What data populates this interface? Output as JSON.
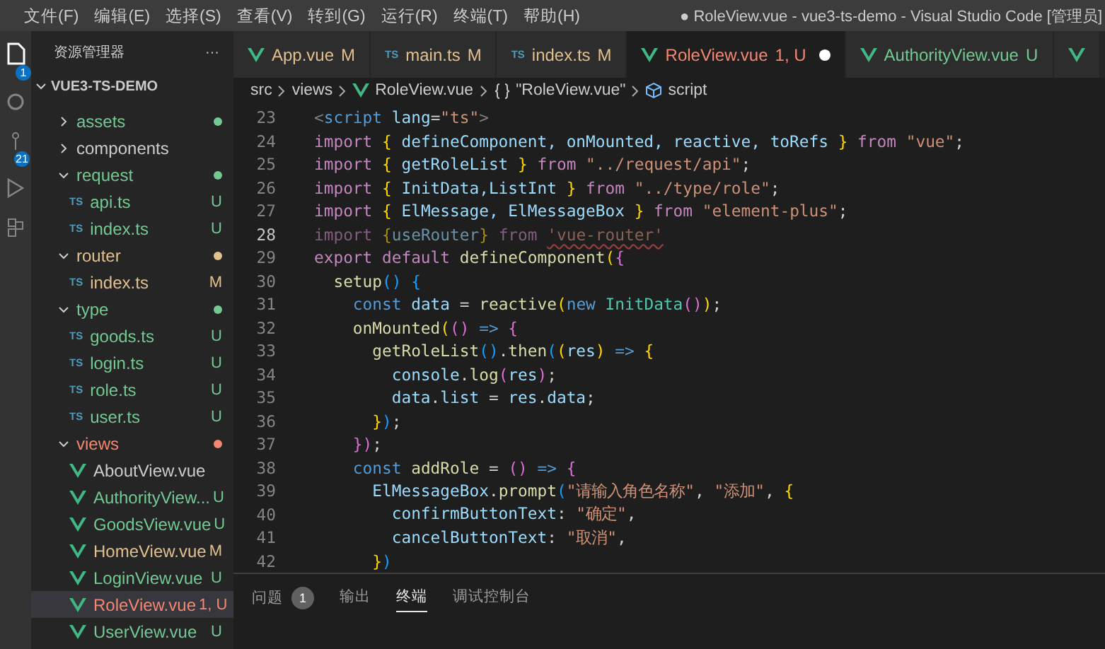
{
  "menu": [
    "文件(F)",
    "编辑(E)",
    "选择(S)",
    "查看(V)",
    "转到(G)",
    "运行(R)",
    "终端(T)",
    "帮助(H)"
  ],
  "window": {
    "title": "● RoleView.vue - vue3-ts-demo - Visual Studio Code [管理员]"
  },
  "activity_bar": {
    "explorer_badge": "1",
    "source_control_badge": "21"
  },
  "sidebar": {
    "title": "资源管理器",
    "more": "···",
    "section": "VUE3-TS-DEMO",
    "items": [
      {
        "label": "assets",
        "kind": "folder",
        "expanded": false,
        "color": "#73c991"
      },
      {
        "label": "components",
        "kind": "folder",
        "expanded": false,
        "color": "#cccccc"
      },
      {
        "label": "request",
        "kind": "folder",
        "expanded": true,
        "color": "#73c991",
        "children": [
          {
            "label": "api.ts",
            "kind": "ts",
            "icon_label": "TS",
            "badge": "U",
            "color": "#73c991",
            "selected": false
          },
          {
            "label": "index.ts",
            "kind": "ts",
            "icon_label": "TS",
            "badge": "U",
            "color": "#73c991",
            "selected": false
          }
        ]
      },
      {
        "label": "router",
        "kind": "folder",
        "expanded": true,
        "color": "#e2c08d",
        "children": [
          {
            "label": "index.ts",
            "kind": "ts",
            "icon_label": "TS",
            "badge": "M",
            "color": "#e2c08d",
            "selected": false
          }
        ]
      },
      {
        "label": "type",
        "kind": "folder",
        "expanded": true,
        "color": "#73c991",
        "children": [
          {
            "label": "goods.ts",
            "kind": "ts",
            "icon_label": "TS",
            "badge": "U",
            "color": "#73c991",
            "selected": false
          },
          {
            "label": "login.ts",
            "kind": "ts",
            "icon_label": "TS",
            "badge": "U",
            "color": "#73c991",
            "selected": false
          },
          {
            "label": "role.ts",
            "kind": "ts",
            "icon_label": "TS",
            "badge": "U",
            "color": "#73c991",
            "selected": false
          },
          {
            "label": "user.ts",
            "kind": "ts",
            "icon_label": "TS",
            "badge": "U",
            "color": "#73c991",
            "selected": false
          }
        ]
      },
      {
        "label": "views",
        "kind": "folder",
        "expanded": true,
        "color": "#f48771",
        "children": [
          {
            "label": "AboutView.vue",
            "kind": "vue",
            "color": "#cccccc",
            "selected": false
          },
          {
            "label": "AuthorityView...",
            "kind": "vue",
            "badge": "U",
            "color": "#73c991",
            "selected": false
          },
          {
            "label": "GoodsView.vue",
            "kind": "vue",
            "badge": "U",
            "color": "#73c991",
            "selected": false
          },
          {
            "label": "HomeView.vue",
            "kind": "vue",
            "badge": "M",
            "color": "#e2c08d",
            "selected": false
          },
          {
            "label": "LoginView.vue",
            "kind": "vue",
            "badge": "U",
            "color": "#73c991",
            "selected": false
          },
          {
            "label": "RoleView.vue",
            "kind": "vue",
            "badge": "1, U",
            "color": "#f48771",
            "selected": true
          },
          {
            "label": "UserView.vue",
            "kind": "vue",
            "badge": "U",
            "color": "#73c991",
            "selected": false
          }
        ]
      }
    ]
  },
  "tabs": [
    {
      "label": "App.vue",
      "kind": "vue",
      "badge": "M",
      "color": "#e2c08d",
      "selected": false,
      "dirty": false
    },
    {
      "label": "main.ts",
      "kind": "ts",
      "icon_label": "TS",
      "badge": "M",
      "color": "#e2c08d",
      "selected": false,
      "dirty": false
    },
    {
      "label": "index.ts",
      "kind": "ts",
      "icon_label": "TS",
      "badge": "M",
      "color": "#e2c08d",
      "selected": false,
      "dirty": false
    },
    {
      "label": "RoleView.vue",
      "kind": "vue",
      "badge": "1, U",
      "color": "#f48771",
      "selected": true,
      "dirty": true
    },
    {
      "label": "AuthorityView.vue",
      "kind": "vue",
      "badge": "U",
      "color": "#73c991",
      "selected": false,
      "dirty": false
    }
  ],
  "breadcrumbs": [
    {
      "label": "src",
      "kind": "folder"
    },
    {
      "label": "views",
      "kind": "folder"
    },
    {
      "label": "RoleView.vue",
      "kind": "vue"
    },
    {
      "label": "\"RoleView.vue\"",
      "kind": "object"
    },
    {
      "label": "script",
      "kind": "module"
    }
  ],
  "code": [
    {
      "number": "23",
      "current": false,
      "unused": false,
      "tokens": [
        {
          "text": "<",
          "kind": "tag"
        },
        {
          "text": "script",
          "kind": "storage"
        },
        {
          "text": " lang",
          "kind": "variable"
        },
        {
          "text": "=",
          "kind": "plain"
        },
        {
          "text": "\"ts\"",
          "kind": "string"
        },
        {
          "text": ">",
          "kind": "tag"
        }
      ]
    },
    {
      "number": "24",
      "current": false,
      "unused": false,
      "tokens": [
        {
          "text": "import ",
          "kind": "keyword"
        },
        {
          "text": "{",
          "kind": "bracket1"
        },
        {
          "text": " defineComponent, onMounted, reactive, toRefs ",
          "kind": "variable"
        },
        {
          "text": "}",
          "kind": "bracket1"
        },
        {
          "text": " from ",
          "kind": "keyword"
        },
        {
          "text": "\"vue\"",
          "kind": "string"
        },
        {
          "text": ";",
          "kind": "plain"
        }
      ]
    },
    {
      "number": "25",
      "current": false,
      "unused": false,
      "tokens": [
        {
          "text": "import ",
          "kind": "keyword"
        },
        {
          "text": "{",
          "kind": "bracket1"
        },
        {
          "text": " getRoleList ",
          "kind": "variable"
        },
        {
          "text": "}",
          "kind": "bracket1"
        },
        {
          "text": " from ",
          "kind": "keyword"
        },
        {
          "text": "\"../request/api\"",
          "kind": "string"
        },
        {
          "text": ";",
          "kind": "plain"
        }
      ]
    },
    {
      "number": "26",
      "current": false,
      "unused": false,
      "tokens": [
        {
          "text": "import ",
          "kind": "keyword"
        },
        {
          "text": "{",
          "kind": "bracket1"
        },
        {
          "text": " InitData,ListInt ",
          "kind": "variable"
        },
        {
          "text": "}",
          "kind": "bracket1"
        },
        {
          "text": " from ",
          "kind": "keyword"
        },
        {
          "text": "\"../type/role\"",
          "kind": "string"
        },
        {
          "text": ";",
          "kind": "plain"
        }
      ]
    },
    {
      "number": "27",
      "current": false,
      "unused": false,
      "tokens": [
        {
          "text": "import ",
          "kind": "keyword"
        },
        {
          "text": "{",
          "kind": "bracket1"
        },
        {
          "text": " ElMessage, ElMessageBox ",
          "kind": "variable"
        },
        {
          "text": "}",
          "kind": "bracket1"
        },
        {
          "text": " from ",
          "kind": "keyword"
        },
        {
          "text": "\"element-plus\"",
          "kind": "string"
        },
        {
          "text": ";",
          "kind": "plain"
        }
      ]
    },
    {
      "number": "28",
      "current": true,
      "unused": true,
      "tokens": [
        {
          "text": "import ",
          "kind": "keyword"
        },
        {
          "text": "{",
          "kind": "bracket1"
        },
        {
          "text": "useRouter",
          "kind": "variable"
        },
        {
          "text": "}",
          "kind": "bracket1"
        },
        {
          "text": " from ",
          "kind": "keyword"
        },
        {
          "text": "'vue-router'",
          "kind": "error"
        }
      ]
    },
    {
      "number": "29",
      "current": false,
      "unused": false,
      "tokens": [
        {
          "text": "export default ",
          "kind": "keyword"
        },
        {
          "text": "defineComponent",
          "kind": "function"
        },
        {
          "text": "(",
          "kind": "bracket1"
        },
        {
          "text": "{",
          "kind": "bracket2"
        }
      ]
    },
    {
      "number": "30",
      "current": false,
      "unused": false,
      "tokens": [
        {
          "text": "  setup",
          "kind": "function"
        },
        {
          "text": "()",
          "kind": "bracket3"
        },
        {
          "text": " {",
          "kind": "bracket3"
        }
      ]
    },
    {
      "number": "31",
      "current": false,
      "unused": false,
      "tokens": [
        {
          "text": "    const",
          "kind": "storage"
        },
        {
          "text": " data",
          "kind": "variable"
        },
        {
          "text": " = ",
          "kind": "plain"
        },
        {
          "text": "reactive",
          "kind": "function"
        },
        {
          "text": "(",
          "kind": "bracket1"
        },
        {
          "text": "new ",
          "kind": "storage"
        },
        {
          "text": "InitData",
          "kind": "class"
        },
        {
          "text": "()",
          "kind": "bracket2"
        },
        {
          "text": ")",
          "kind": "bracket1"
        },
        {
          "text": ";",
          "kind": "plain"
        }
      ]
    },
    {
      "number": "32",
      "current": false,
      "unused": false,
      "tokens": [
        {
          "text": "    onMounted",
          "kind": "function"
        },
        {
          "text": "(",
          "kind": "bracket1"
        },
        {
          "text": "()",
          "kind": "bracket2"
        },
        {
          "text": " => ",
          "kind": "storage"
        },
        {
          "text": "{",
          "kind": "bracket2"
        }
      ]
    },
    {
      "number": "33",
      "current": false,
      "unused": false,
      "tokens": [
        {
          "text": "      getRoleList",
          "kind": "function"
        },
        {
          "text": "()",
          "kind": "bracket3"
        },
        {
          "text": ".",
          "kind": "plain"
        },
        {
          "text": "then",
          "kind": "function"
        },
        {
          "text": "(",
          "kind": "bracket3"
        },
        {
          "text": "(",
          "kind": "bracket1"
        },
        {
          "text": "res",
          "kind": "variable"
        },
        {
          "text": ")",
          "kind": "bracket1"
        },
        {
          "text": " => ",
          "kind": "storage"
        },
        {
          "text": "{",
          "kind": "bracket1"
        }
      ]
    },
    {
      "number": "34",
      "current": false,
      "unused": false,
      "tokens": [
        {
          "text": "        console",
          "kind": "variable"
        },
        {
          "text": ".",
          "kind": "plain"
        },
        {
          "text": "log",
          "kind": "function"
        },
        {
          "text": "(",
          "kind": "bracket2"
        },
        {
          "text": "res",
          "kind": "variable"
        },
        {
          "text": ")",
          "kind": "bracket2"
        },
        {
          "text": ";",
          "kind": "plain"
        }
      ]
    },
    {
      "number": "35",
      "current": false,
      "unused": false,
      "tokens": [
        {
          "text": "        data",
          "kind": "variable"
        },
        {
          "text": ".",
          "kind": "plain"
        },
        {
          "text": "list",
          "kind": "variable"
        },
        {
          "text": " = ",
          "kind": "plain"
        },
        {
          "text": "res",
          "kind": "variable"
        },
        {
          "text": ".",
          "kind": "plain"
        },
        {
          "text": "data",
          "kind": "variable"
        },
        {
          "text": ";",
          "kind": "plain"
        }
      ]
    },
    {
      "number": "36",
      "current": false,
      "unused": false,
      "tokens": [
        {
          "text": "      }",
          "kind": "bracket1"
        },
        {
          "text": ")",
          "kind": "bracket3"
        },
        {
          "text": ";",
          "kind": "plain"
        }
      ]
    },
    {
      "number": "37",
      "current": false,
      "unused": false,
      "tokens": [
        {
          "text": "    })",
          "kind": "bracket2"
        },
        {
          "text": ";",
          "kind": "plain"
        }
      ]
    },
    {
      "number": "38",
      "current": false,
      "unused": false,
      "tokens": [
        {
          "text": "    const",
          "kind": "storage"
        },
        {
          "text": " addRole",
          "kind": "function"
        },
        {
          "text": " = ",
          "kind": "plain"
        },
        {
          "text": "()",
          "kind": "bracket2"
        },
        {
          "text": " => ",
          "kind": "storage"
        },
        {
          "text": "{",
          "kind": "bracket2"
        }
      ]
    },
    {
      "number": "39",
      "current": false,
      "unused": false,
      "tokens": [
        {
          "text": "      ElMessageBox",
          "kind": "variable"
        },
        {
          "text": ".",
          "kind": "plain"
        },
        {
          "text": "prompt",
          "kind": "function"
        },
        {
          "text": "(",
          "kind": "bracket3"
        },
        {
          "text": "\"请输入角色名称\"",
          "kind": "string"
        },
        {
          "text": ", ",
          "kind": "plain"
        },
        {
          "text": "\"添加\"",
          "kind": "string"
        },
        {
          "text": ", ",
          "kind": "plain"
        },
        {
          "text": "{",
          "kind": "bracket1"
        }
      ]
    },
    {
      "number": "40",
      "current": false,
      "unused": false,
      "tokens": [
        {
          "text": "        confirmButtonText",
          "kind": "variable"
        },
        {
          "text": ": ",
          "kind": "plain"
        },
        {
          "text": "\"确定\"",
          "kind": "string"
        },
        {
          "text": ",",
          "kind": "plain"
        }
      ]
    },
    {
      "number": "41",
      "current": false,
      "unused": false,
      "tokens": [
        {
          "text": "        cancelButtonText",
          "kind": "variable"
        },
        {
          "text": ": ",
          "kind": "plain"
        },
        {
          "text": "\"取消\"",
          "kind": "string"
        },
        {
          "text": ",",
          "kind": "plain"
        }
      ]
    },
    {
      "number": "42",
      "current": false,
      "unused": false,
      "tokens": [
        {
          "text": "      }",
          "kind": "bracket1"
        },
        {
          "text": ")",
          "kind": "bracket3"
        }
      ]
    }
  ],
  "panel": {
    "tabs": [
      {
        "label": "问题",
        "badge": "1",
        "selected": false
      },
      {
        "label": "输出",
        "selected": false
      },
      {
        "label": "终端",
        "selected": true
      },
      {
        "label": "调试控制台",
        "selected": false
      }
    ]
  }
}
